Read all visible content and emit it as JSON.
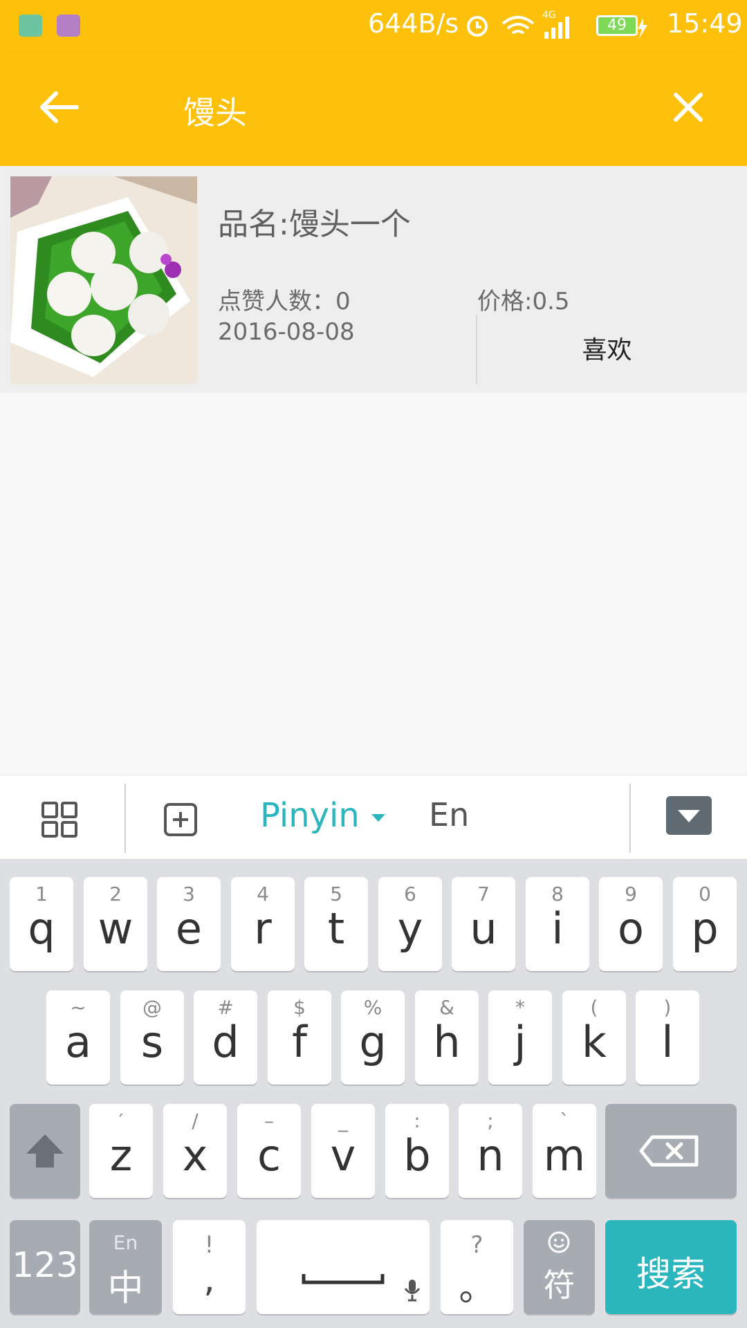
{
  "status_bar": {
    "speed": "644B/s",
    "battery": "49",
    "time": "15:49"
  },
  "toolbar": {
    "title": "馒头"
  },
  "product": {
    "name": "品名:馒头一个",
    "likes": "点赞人数：0",
    "date": "2016-08-08",
    "price": "价格:0.5",
    "like_button": "喜欢"
  },
  "ime": {
    "pinyin_label": "Pinyin",
    "en_label": "En"
  },
  "keyboard": {
    "row1": [
      {
        "hint": "1",
        "key": "q"
      },
      {
        "hint": "2",
        "key": "w"
      },
      {
        "hint": "3",
        "key": "e"
      },
      {
        "hint": "4",
        "key": "r"
      },
      {
        "hint": "5",
        "key": "t"
      },
      {
        "hint": "6",
        "key": "y"
      },
      {
        "hint": "7",
        "key": "u"
      },
      {
        "hint": "8",
        "key": "i"
      },
      {
        "hint": "9",
        "key": "o"
      },
      {
        "hint": "0",
        "key": "p"
      }
    ],
    "row2": [
      {
        "hint": "~",
        "key": "a"
      },
      {
        "hint": "@",
        "key": "s"
      },
      {
        "hint": "#",
        "key": "d"
      },
      {
        "hint": "$",
        "key": "f"
      },
      {
        "hint": "%",
        "key": "g"
      },
      {
        "hint": "&",
        "key": "h"
      },
      {
        "hint": "*",
        "key": "j"
      },
      {
        "hint": "(",
        "key": "k"
      },
      {
        "hint": ")",
        "key": "l"
      }
    ],
    "row3": [
      {
        "hint": "′",
        "key": "z"
      },
      {
        "hint": "/",
        "key": "x"
      },
      {
        "hint": "–",
        "key": "c"
      },
      {
        "hint": "_",
        "key": "v"
      },
      {
        "hint": ":",
        "key": "b"
      },
      {
        "hint": ";",
        "key": "n"
      },
      {
        "hint": "`",
        "key": "m"
      }
    ],
    "num_label": "123",
    "lang_hint": "En",
    "lang_label": "中",
    "comma_hint": "!",
    "comma_label": ",",
    "period_hint": "?",
    "period_label": "。",
    "symbol_label": "符",
    "search_label": "搜索"
  },
  "icons": {
    "back": "arrow-left-icon",
    "close": "close-icon",
    "shift": "shift-icon",
    "backspace": "backspace-icon",
    "mic": "microphone-icon",
    "emoji": "emoji-icon"
  },
  "colors": {
    "toolbar": "#fdc10c",
    "accent": "#2bb5bc"
  }
}
